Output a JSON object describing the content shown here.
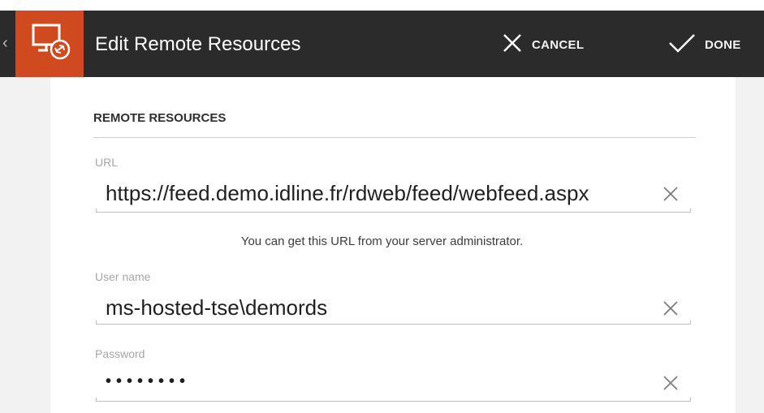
{
  "header": {
    "title": "Edit Remote Resources",
    "cancel_label": "CANCEL",
    "done_label": "DONE",
    "back_glyph": "‹"
  },
  "colors": {
    "app_bar": "#2b2b2b",
    "app_icon_bg": "#d04a1f"
  },
  "form": {
    "section_title": "REMOTE RESOURCES",
    "url": {
      "label": "URL",
      "value": "https://feed.demo.idline.fr/rdweb/feed/webfeed.aspx",
      "hint": "You can get this URL from your server administrator."
    },
    "username": {
      "label": "User name",
      "value": "ms-hosted-tse\\demords"
    },
    "password": {
      "label": "Password",
      "masked_value": "••••••••"
    }
  },
  "icons": {
    "app": "remote-desktop-icon",
    "cancel": "close-icon",
    "done": "checkmark-icon",
    "clear": "clear-field-icon"
  }
}
